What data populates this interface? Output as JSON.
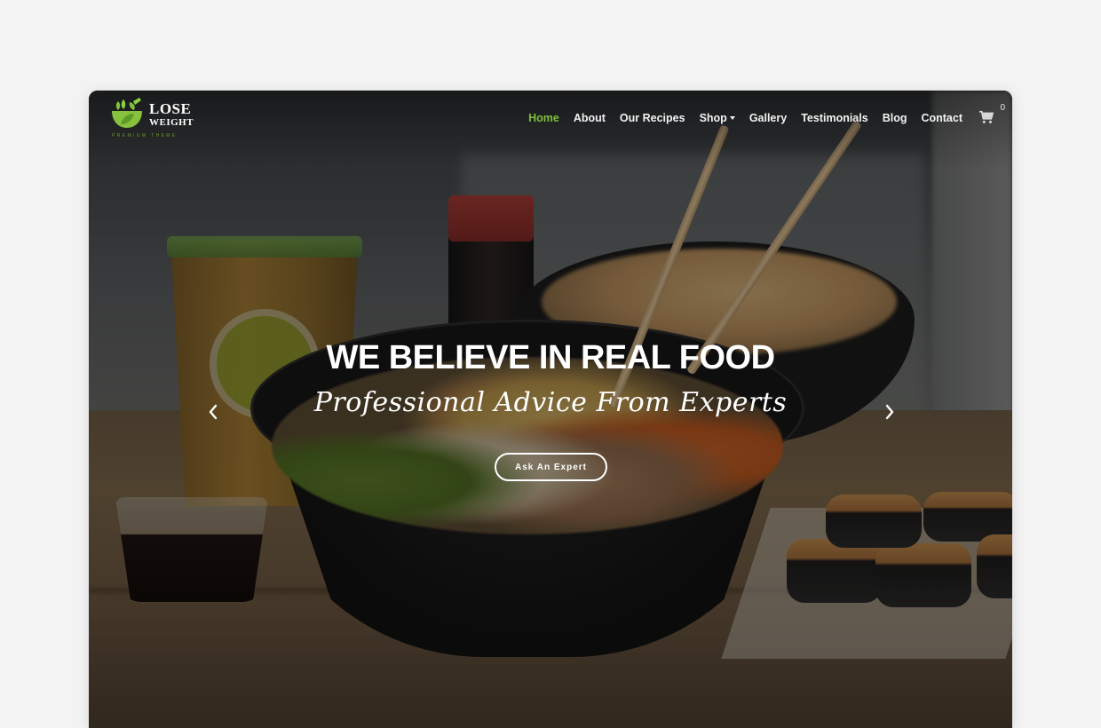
{
  "brand": {
    "name_line1": "LOSE",
    "name_line2": "WEIGHT",
    "tagline": "PREMIUM THEME",
    "accent_color": "#7fbf3a"
  },
  "nav": {
    "items": [
      {
        "label": "Home",
        "active": true
      },
      {
        "label": "About",
        "active": false
      },
      {
        "label": "Our Recipes",
        "active": false
      },
      {
        "label": "Shop",
        "active": false,
        "has_dropdown": true
      },
      {
        "label": "Gallery",
        "active": false
      },
      {
        "label": "Testimonials",
        "active": false
      },
      {
        "label": "Blog",
        "active": false
      },
      {
        "label": "Contact",
        "active": false
      }
    ],
    "cart_icon": "cart-icon",
    "cart_count": "0"
  },
  "hero": {
    "headline": "WE BELIEVE IN REAL FOOD",
    "subheadline": "Professional Advice From Experts",
    "cta_label": "Ask An Expert",
    "prev_icon": "chevron-left-icon",
    "next_icon": "chevron-right-icon"
  }
}
